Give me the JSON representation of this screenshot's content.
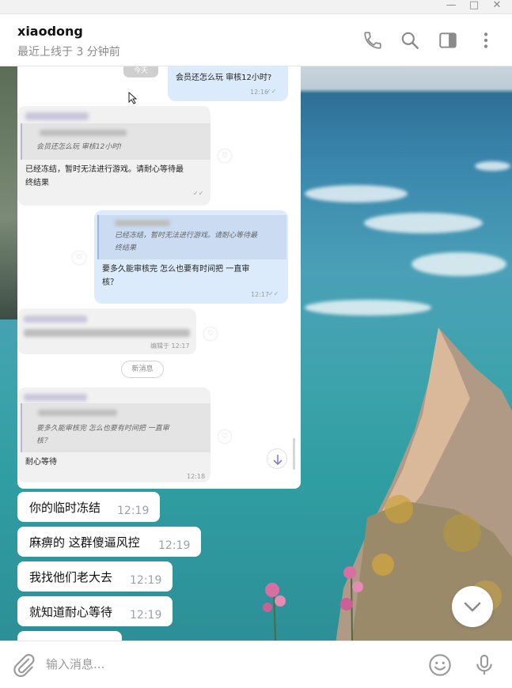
{
  "window": {
    "minimize_glyph": "—",
    "maximize_glyph": "□",
    "close_glyph": "✕"
  },
  "header": {
    "name": "xiaodong",
    "status": "最近上线于 3 分钟前",
    "icons": [
      "phone-icon",
      "search-icon",
      "sidebar-toggle-icon",
      "more-vertical-icon"
    ]
  },
  "screenshot": {
    "partial_label": "今天",
    "out1": {
      "text": "会员还怎么玩 审核12小时?",
      "time": "12:16"
    },
    "in1": {
      "quote": "会员还怎么玩 审核12小时!",
      "text_line1": "已经冻结，暂时无法进行游戏。请耐心等待最",
      "text_line2": "终结果"
    },
    "out2": {
      "quote_line1": "已经冻结，暂时无法进行游戏。请耐心等待最",
      "quote_line2": "终结果",
      "text_line1": "要多久能审核完   怎么也要有时间把   一直审",
      "text_line2": "核？",
      "time": "12:17"
    },
    "in2": {
      "time": "编辑于 12:17"
    },
    "new_messages": "新消息",
    "in3": {
      "quote_line1": "要多久能审核完   怎么也要有时间把   一直审",
      "quote_line2": "核？",
      "text": "耐心等待",
      "time": "12:18"
    }
  },
  "messages": [
    {
      "text": "你的临时冻结",
      "time": "12:19"
    },
    {
      "text": "麻痹的 这群傻逼风控",
      "time": "12:19"
    },
    {
      "text": "我找他们老大去",
      "time": "12:19"
    },
    {
      "text": "就知道耐心等待",
      "time": "12:19"
    }
  ],
  "input": {
    "placeholder": "输入消息...",
    "icons": [
      "attach-icon",
      "emoji-icon",
      "microphone-icon"
    ]
  },
  "colors": {
    "incoming_bubble": "#ffffff",
    "outgoing_bubble": "#dcebfb",
    "time_text": "#9aa3a7"
  }
}
